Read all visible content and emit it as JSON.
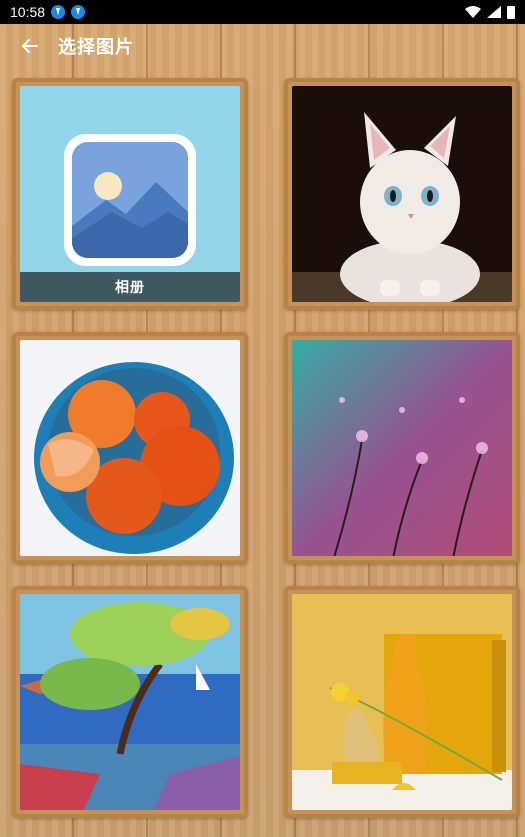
{
  "status_bar": {
    "time": "10:58",
    "notification_icons": [
      "download-icon",
      "download-icon"
    ],
    "right_icons": [
      "wifi-icon",
      "signal-icon",
      "battery-icon"
    ]
  },
  "app_bar": {
    "back_icon": "arrow-left-icon",
    "title": "选择图片"
  },
  "grid": {
    "items": [
      {
        "type": "album",
        "label": "相册",
        "icon": "gallery-icon"
      },
      {
        "type": "image",
        "subject": "kitten"
      },
      {
        "type": "image",
        "subject": "tangerines-bowl"
      },
      {
        "type": "image",
        "subject": "dandelion-droplets"
      },
      {
        "type": "image",
        "subject": "tree-painting"
      },
      {
        "type": "image",
        "subject": "yellow-vase-still-life"
      }
    ]
  },
  "colors": {
    "accent_album_bg": "#93d6ea",
    "album_label_bg": "#3f5961",
    "card_frame": "#b78347"
  }
}
